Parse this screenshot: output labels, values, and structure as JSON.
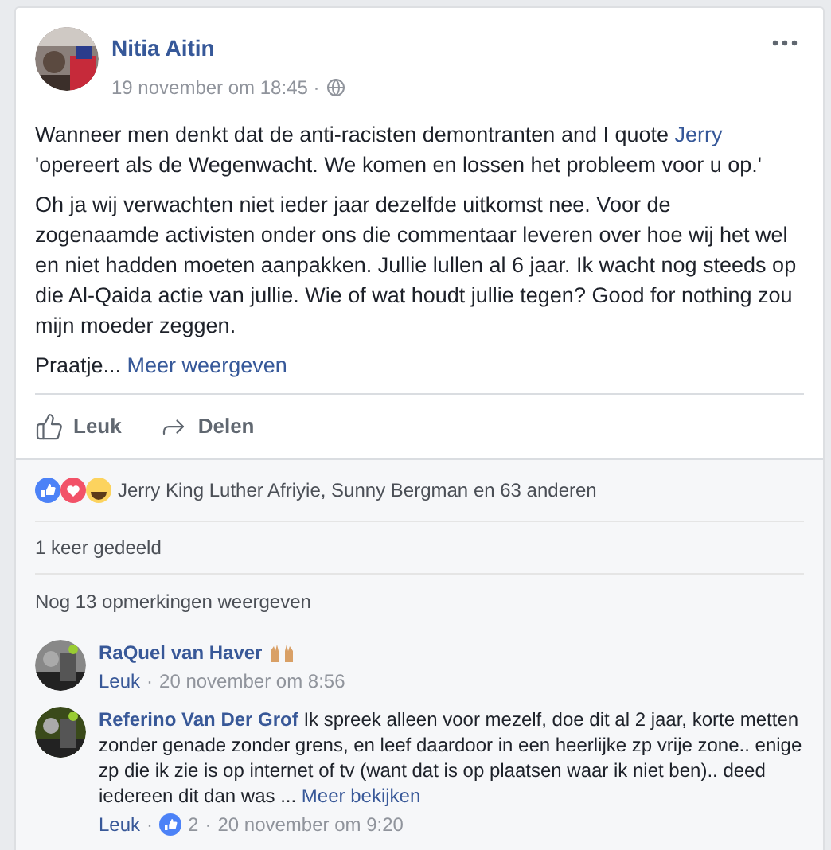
{
  "post": {
    "author": "Nitia Aitin",
    "time": "19 november om 18:45 ·",
    "paragraphs": [
      {
        "before": "Wanneer men denkt dat de anti-racisten demontranten and I quote ",
        "link": "Jerry",
        "after": " 'opereert als de Wegenwacht. We komen en lossen het probleem voor u op.'"
      },
      {
        "before": "Oh ja wij verwachten niet ieder jaar dezelfde uitkomst nee. Voor de zogenaamde activisten onder ons die commentaar leveren over hoe wij het wel en niet hadden moeten aanpakken. Jullie lullen al 6 jaar. Ik wacht nog steeds op die Al-Qaida actie van jullie. Wie of wat houdt jullie tegen? Good for nothing zou mijn moeder zeggen."
      }
    ],
    "teaser": "Praatje...",
    "more": "Meer weergeven"
  },
  "actions": [
    {
      "kind": "like",
      "label": "Leuk"
    },
    {
      "kind": "share",
      "label": "Delen"
    }
  ],
  "reactions": {
    "text": "Jerry King Luther Afriyie, Sunny Bergman en 63 anderen"
  },
  "shares": "1 keer gedeeld",
  "more_comments": "Nog 13 opmerkingen weergeven",
  "comments": [
    {
      "author": "RaQuel van Haver",
      "emoji": true,
      "like": "Leuk",
      "separators": [
        "·"
      ],
      "time": "20 november om 8:56"
    },
    {
      "author": "Referino Van Der Grof",
      "emoji": false,
      "text": "Ik spreek alleen voor mezelf, doe dit al 2 jaar, korte metten zonder genade zonder grens, en leef daardoor in een heerlijke zp vrije zone.. enige zp die ik zie is op internet of tv (want dat is op plaatsen waar ik niet ben).. deed iedereen dit dan was ...",
      "more": "Meer bekijken",
      "like": "Leuk",
      "likes": "2",
      "separators": [
        "·",
        "·"
      ],
      "time": "20 november om 9:20"
    }
  ]
}
